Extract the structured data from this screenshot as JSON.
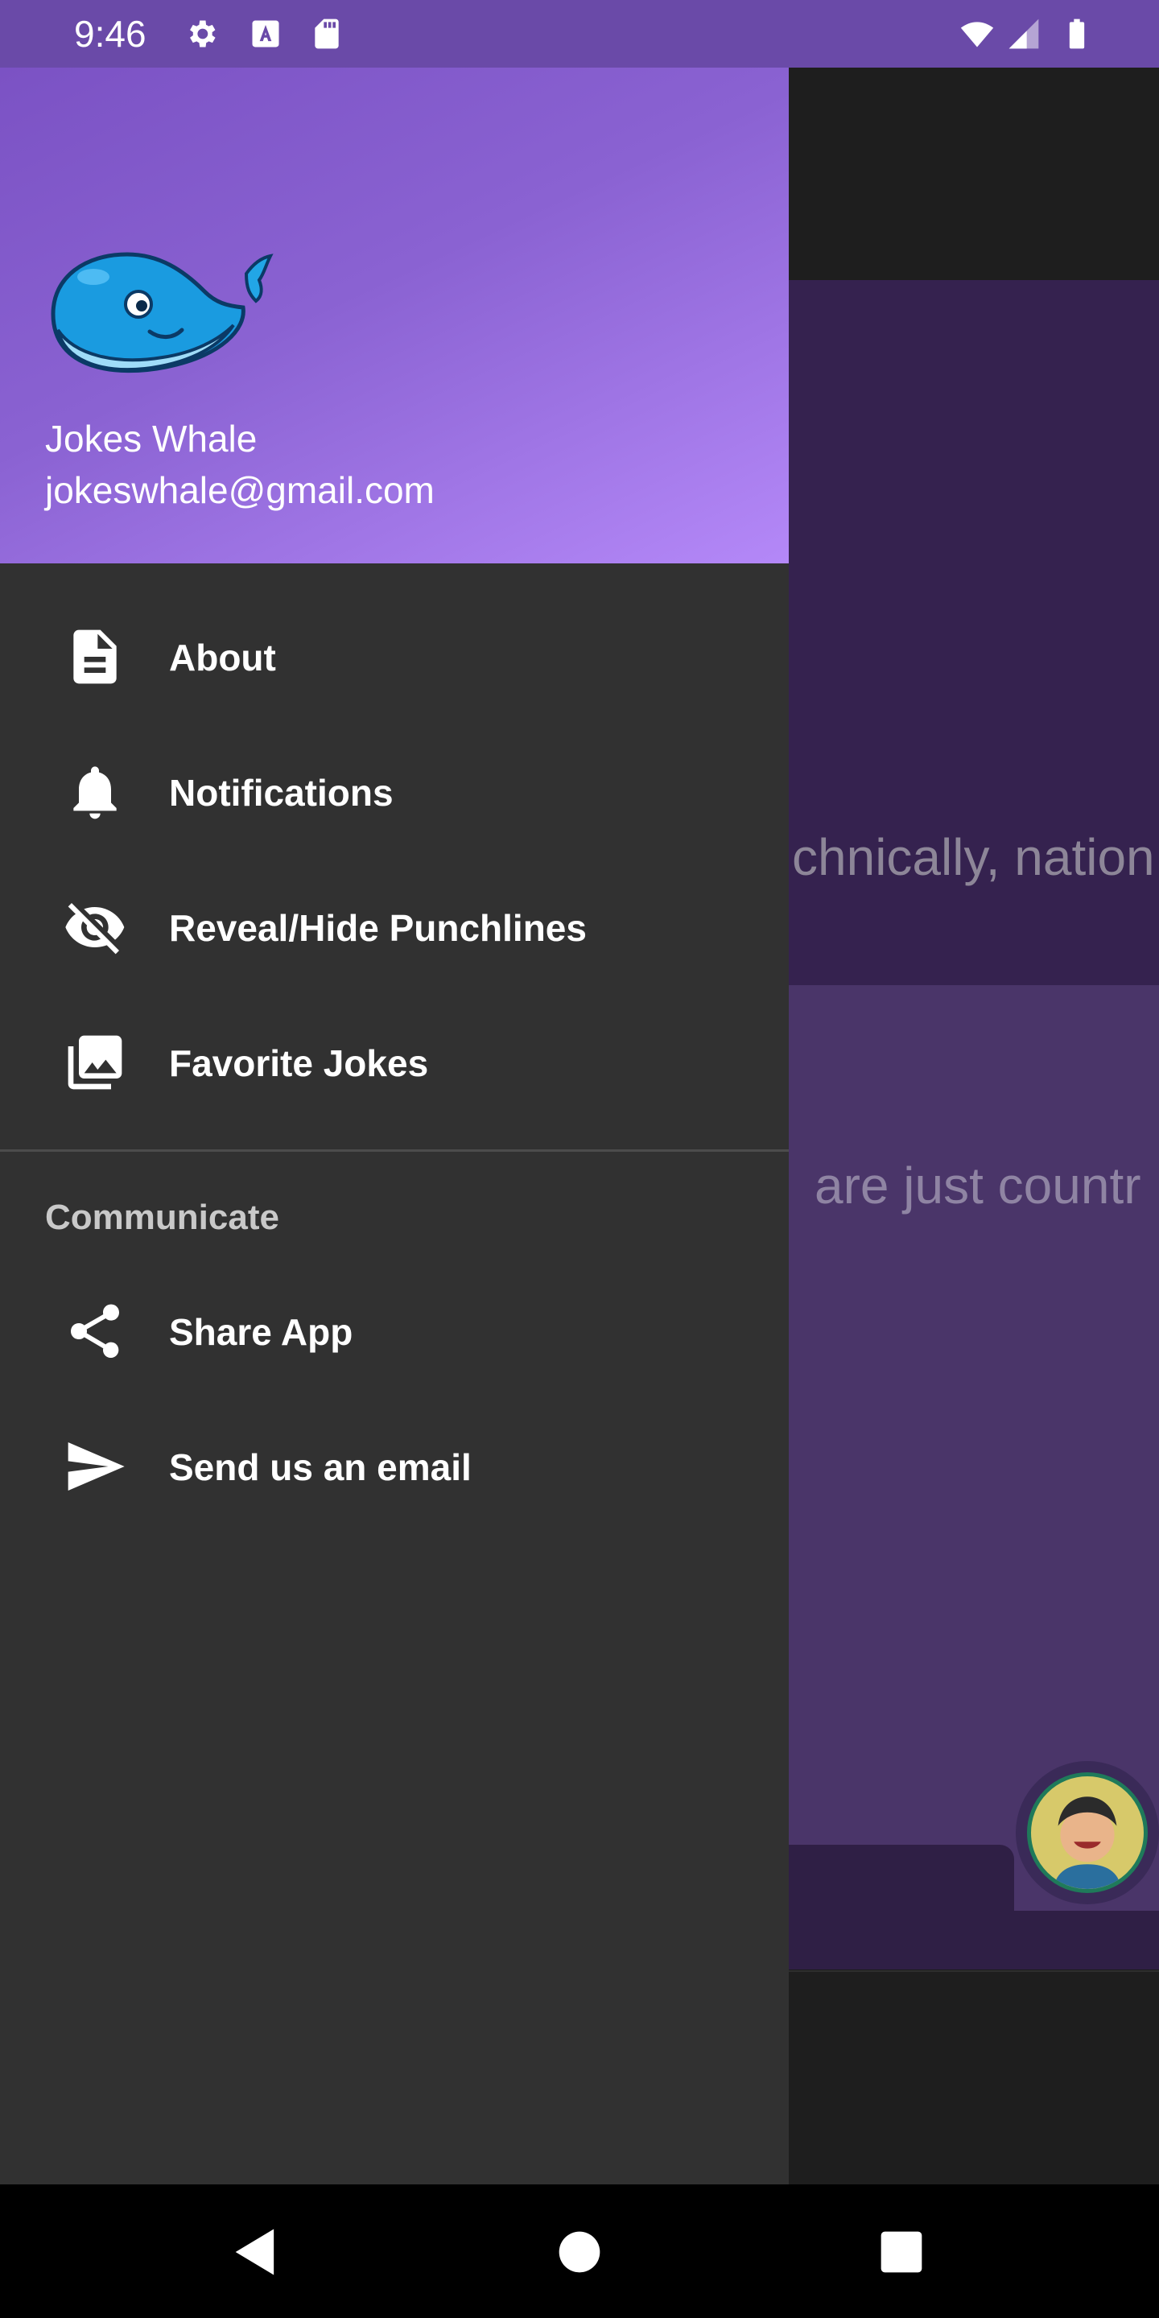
{
  "status_bar": {
    "time": "9:46",
    "icons": [
      "settings-icon",
      "a-badge-icon",
      "sd-card-icon",
      "wifi-icon",
      "signal-icon",
      "battery-icon"
    ]
  },
  "background": {
    "card1_text": "chnically, nation",
    "card2_text": "are just countr"
  },
  "drawer": {
    "header": {
      "name": "Jokes Whale",
      "email": "jokeswhale@gmail.com"
    },
    "items": [
      {
        "label": "About",
        "icon": "document-icon"
      },
      {
        "label": "Notifications",
        "icon": "bell-icon"
      },
      {
        "label": "Reveal/Hide Punchlines",
        "icon": "eye-off-icon"
      },
      {
        "label": "Favorite Jokes",
        "icon": "photo-library-icon"
      }
    ],
    "section_title": "Communicate",
    "communicate_items": [
      {
        "label": "Share App",
        "icon": "share-icon"
      },
      {
        "label": "Send us an email",
        "icon": "send-icon"
      }
    ]
  },
  "colors": {
    "status_bar": "#6a4aa8",
    "drawer_bg": "#313131",
    "header_gradient_start": "#7b52c4",
    "header_gradient_end": "#b488f8"
  }
}
